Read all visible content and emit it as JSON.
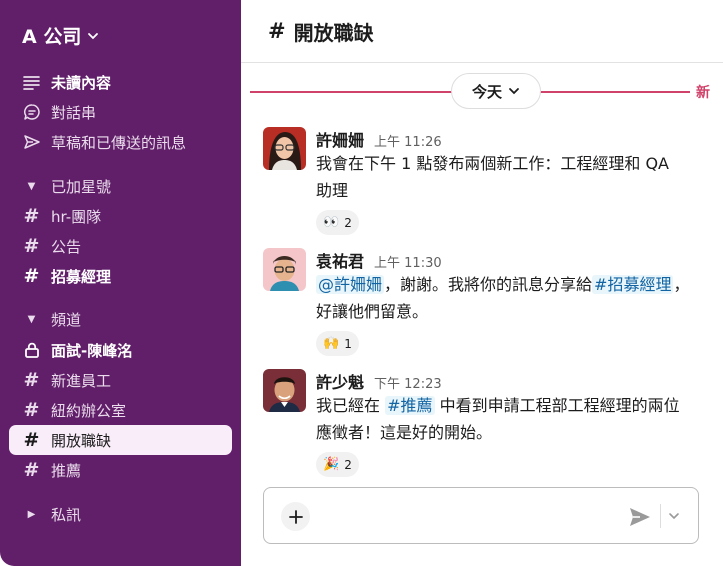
{
  "workspace": {
    "name": "A 公司"
  },
  "sidebar": {
    "top_items": [
      {
        "label": "未讀內容",
        "icon": "unread-icon"
      },
      {
        "label": "對話串",
        "icon": "threads-icon"
      },
      {
        "label": "草稿和已傳送的訊息",
        "icon": "send-icon"
      }
    ],
    "starred": {
      "label": "已加星號",
      "channels": [
        "hr-團隊",
        "公告",
        "招募經理"
      ]
    },
    "channels_section": {
      "label": "頻道",
      "channels": [
        "面試-陳峰洺",
        "新進員工",
        "紐約辦公室",
        "開放職缺",
        "推薦"
      ]
    },
    "dm_section": {
      "label": "私訊"
    }
  },
  "channel": {
    "name": "開放職缺"
  },
  "date_divider": {
    "label": "今天",
    "new_label": "新"
  },
  "messages": [
    {
      "sender": "許姍姍",
      "time": "上午 11:26",
      "text_lines": [
        "我會在下午 1 點發布兩個新工作：工程經理和 QA",
        "助理"
      ],
      "reaction": {
        "emoji": "👀",
        "count": "2"
      }
    },
    {
      "sender": "袁祐君",
      "time": "上午 11:30",
      "mention": "@許姍姍",
      "text_mid": "，謝謝。我將你的訊息分享給",
      "channel_link": "#招募經理",
      "text_end": "，",
      "text_line2": "好讓他們留意。",
      "reaction": {
        "emoji": "🙌",
        "count": "1"
      }
    },
    {
      "sender": "許少魁",
      "time": "下午 12:23",
      "text_start": "我已經在 ",
      "channel_link": "#推薦",
      "text_rest": " 中看到申請工程部工程經理的兩位",
      "text_line2": "應徵者！這是好的開始。",
      "reaction": {
        "emoji": "🎉",
        "count": "2"
      }
    }
  ],
  "colors": {
    "sidebar": "#611f69",
    "accent_divider": "#d0426a",
    "mention_text": "#1264a3"
  }
}
